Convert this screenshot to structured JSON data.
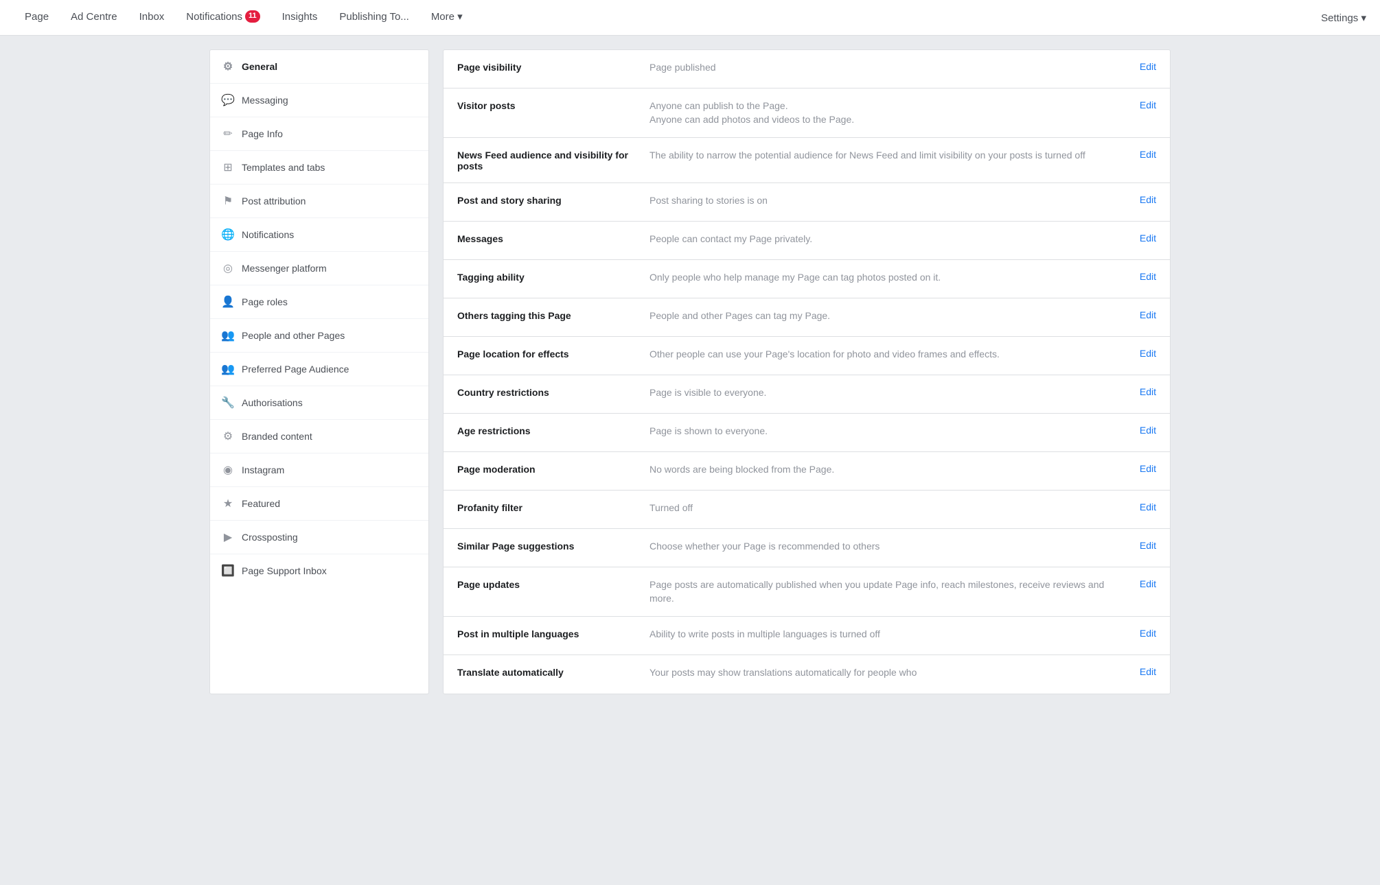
{
  "nav": {
    "items": [
      {
        "id": "page",
        "label": "Page",
        "active": false,
        "badge": null
      },
      {
        "id": "ad-centre",
        "label": "Ad Centre",
        "active": false,
        "badge": null
      },
      {
        "id": "inbox",
        "label": "Inbox",
        "active": false,
        "badge": null
      },
      {
        "id": "notifications",
        "label": "Notifications",
        "active": false,
        "badge": "11"
      },
      {
        "id": "insights",
        "label": "Insights",
        "active": false,
        "badge": null
      },
      {
        "id": "publishing",
        "label": "Publishing To...",
        "active": false,
        "badge": null
      },
      {
        "id": "more",
        "label": "More ▾",
        "active": false,
        "badge": null
      }
    ],
    "settings_label": "Settings ▾"
  },
  "sidebar": {
    "items": [
      {
        "id": "general",
        "label": "General",
        "icon": "⚙",
        "active": true
      },
      {
        "id": "messaging",
        "label": "Messaging",
        "icon": "💬",
        "active": false
      },
      {
        "id": "page-info",
        "label": "Page Info",
        "icon": "✏",
        "active": false
      },
      {
        "id": "templates-tabs",
        "label": "Templates and tabs",
        "icon": "⊞",
        "active": false
      },
      {
        "id": "post-attribution",
        "label": "Post attribution",
        "icon": "⚑",
        "active": false
      },
      {
        "id": "notifications",
        "label": "Notifications",
        "icon": "🌐",
        "active": false
      },
      {
        "id": "messenger-platform",
        "label": "Messenger platform",
        "icon": "◎",
        "active": false
      },
      {
        "id": "page-roles",
        "label": "Page roles",
        "icon": "👤",
        "active": false
      },
      {
        "id": "people-other-pages",
        "label": "People and other Pages",
        "icon": "👥",
        "active": false
      },
      {
        "id": "preferred-audience",
        "label": "Preferred Page Audience",
        "icon": "👥",
        "active": false
      },
      {
        "id": "authorisations",
        "label": "Authorisations",
        "icon": "🔧",
        "active": false
      },
      {
        "id": "branded-content",
        "label": "Branded content",
        "icon": "⚙",
        "active": false
      },
      {
        "id": "instagram",
        "label": "Instagram",
        "icon": "◉",
        "active": false
      },
      {
        "id": "featured",
        "label": "Featured",
        "icon": "★",
        "active": false
      },
      {
        "id": "crossposting",
        "label": "Crossposting",
        "icon": "▶",
        "active": false
      },
      {
        "id": "page-support-inbox",
        "label": "Page Support Inbox",
        "icon": "🔲",
        "active": false
      }
    ]
  },
  "settings_rows": [
    {
      "id": "page-visibility",
      "label": "Page visibility",
      "value": "Page published",
      "edit": "Edit"
    },
    {
      "id": "visitor-posts",
      "label": "Visitor posts",
      "value": "Anyone can publish to the Page.\nAnyone can add photos and videos to the Page.",
      "edit": "Edit"
    },
    {
      "id": "news-feed-audience",
      "label": "News Feed audience and visibility for posts",
      "value": "The ability to narrow the potential audience for News Feed and limit visibility on your posts is turned off",
      "edit": "Edit"
    },
    {
      "id": "post-story-sharing",
      "label": "Post and story sharing",
      "value": "Post sharing to stories is on",
      "edit": "Edit"
    },
    {
      "id": "messages",
      "label": "Messages",
      "value": "People can contact my Page privately.",
      "edit": "Edit"
    },
    {
      "id": "tagging-ability",
      "label": "Tagging ability",
      "value": "Only people who help manage my Page can tag photos posted on it.",
      "edit": "Edit"
    },
    {
      "id": "others-tagging",
      "label": "Others tagging this Page",
      "value": "People and other Pages can tag my Page.",
      "edit": "Edit"
    },
    {
      "id": "page-location-effects",
      "label": "Page location for effects",
      "value": "Other people can use your Page's location for photo and video frames and effects.",
      "edit": "Edit"
    },
    {
      "id": "country-restrictions",
      "label": "Country restrictions",
      "value": "Page is visible to everyone.",
      "edit": "Edit"
    },
    {
      "id": "age-restrictions",
      "label": "Age restrictions",
      "value": "Page is shown to everyone.",
      "edit": "Edit"
    },
    {
      "id": "page-moderation",
      "label": "Page moderation",
      "value": "No words are being blocked from the Page.",
      "edit": "Edit"
    },
    {
      "id": "profanity-filter",
      "label": "Profanity filter",
      "value": "Turned off",
      "edit": "Edit"
    },
    {
      "id": "similar-page-suggestions",
      "label": "Similar Page suggestions",
      "value": "Choose whether your Page is recommended to others",
      "edit": "Edit"
    },
    {
      "id": "page-updates",
      "label": "Page updates",
      "value": "Page posts are automatically published when you update Page info, reach milestones, receive reviews and more.",
      "edit": "Edit"
    },
    {
      "id": "post-multiple-languages",
      "label": "Post in multiple languages",
      "value": "Ability to write posts in multiple languages is turned off",
      "edit": "Edit"
    },
    {
      "id": "translate-automatically",
      "label": "Translate automatically",
      "value": "Your posts may show translations automatically for people who",
      "edit": "Edit"
    }
  ]
}
